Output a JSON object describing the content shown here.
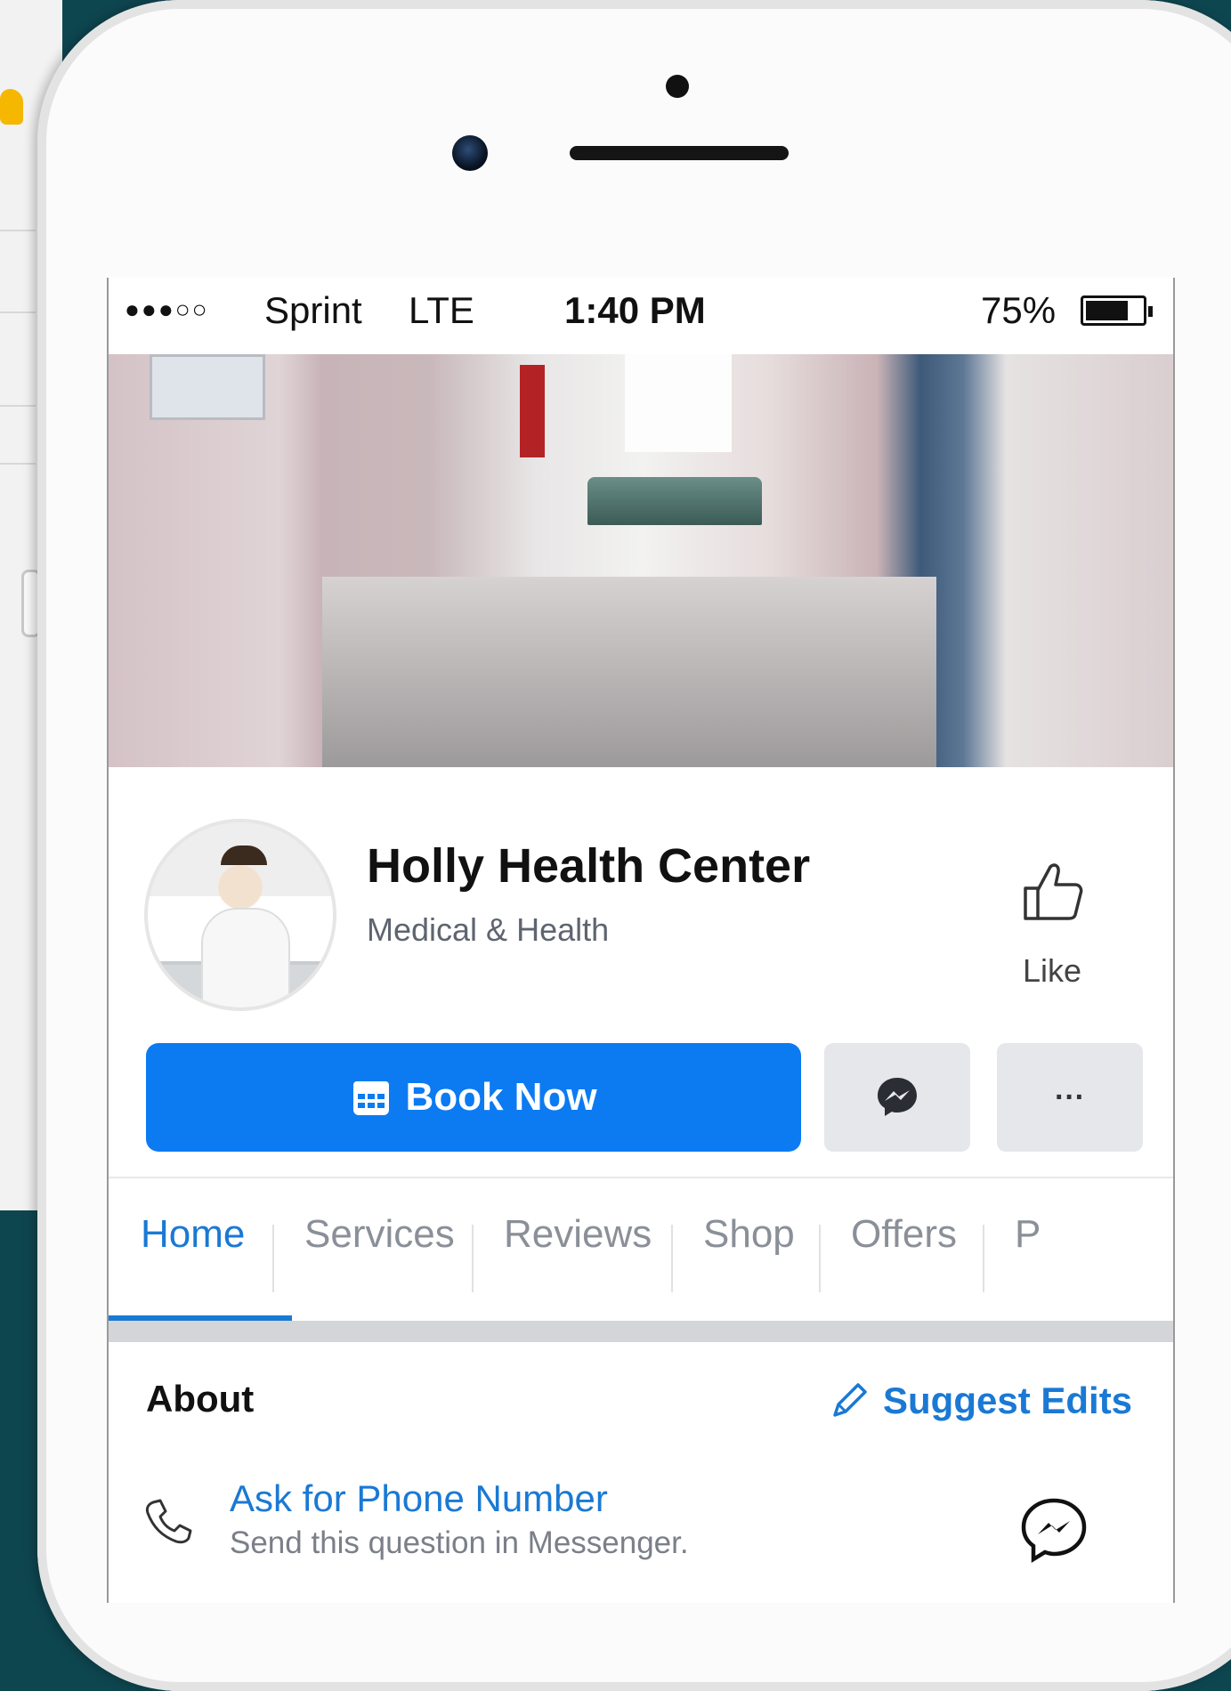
{
  "status_bar": {
    "signal": "●●●○○",
    "carrier": "Sprint",
    "network": "LTE",
    "time": "1:40 PM",
    "battery_percent": "75%",
    "battery_level": 0.75
  },
  "page": {
    "name": "Holly Health Center",
    "category": "Medical & Health",
    "like_label": "Like"
  },
  "actions": {
    "book_label": "Book Now",
    "more_label": "···",
    "icons": {
      "book": "calendar-icon",
      "message": "messenger-icon",
      "more": "more-icon"
    }
  },
  "tabs": [
    {
      "label": "Home",
      "active": true
    },
    {
      "label": "Services",
      "active": false
    },
    {
      "label": "Reviews",
      "active": false
    },
    {
      "label": "Shop",
      "active": false
    },
    {
      "label": "Offers",
      "active": false
    },
    {
      "label": "P",
      "active": false
    }
  ],
  "about": {
    "title": "About",
    "suggest_label": "Suggest Edits",
    "contact": {
      "title": "Ask for Phone Number",
      "subtitle": "Send this question in Messenger."
    }
  },
  "colors": {
    "accent": "#1a79d4",
    "button_blue": "#0c7bf2",
    "background": "#0e4650"
  }
}
